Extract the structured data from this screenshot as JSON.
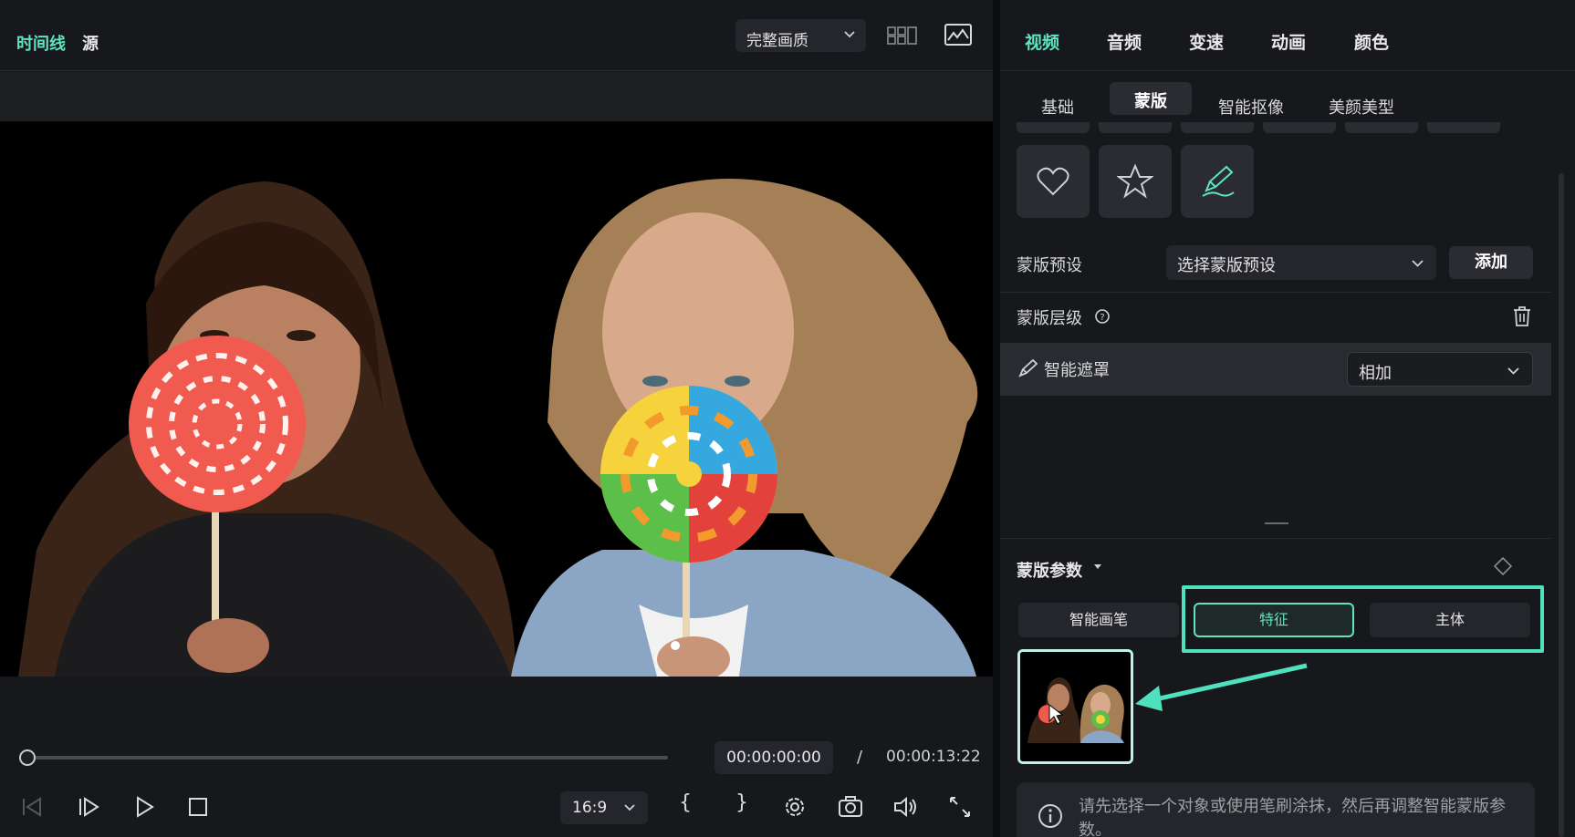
{
  "preview": {
    "tabs": [
      "时间线",
      "源"
    ],
    "quality_label": "完整画质",
    "current_time": "00:00:00:00",
    "separator": "/",
    "total_time": "00:00:13:22",
    "ratio": "16:9",
    "brace_open": "{",
    "brace_close": "}"
  },
  "panel": {
    "tabs": [
      "视频",
      "音频",
      "变速",
      "动画",
      "颜色"
    ],
    "subtabs": [
      "基础",
      "蒙版",
      "智能抠像",
      "美颜美型"
    ],
    "preset_label": "蒙版预设",
    "preset_placeholder": "选择蒙版预设",
    "add_label": "添加",
    "layer_label": "蒙版层级",
    "smart_mask_label": "智能遮罩",
    "blend_mode": "相加",
    "params_label": "蒙版参数",
    "modes": [
      "智能画笔",
      "特征",
      "主体"
    ],
    "info_text": "请先选择一个对象或使用笔刷涂抹，然后再调整智能蒙版参数。"
  },
  "colors": {
    "accent": "#5fe3c0",
    "highlight": "#4fe1bd"
  },
  "icons": [
    "heart-icon",
    "star-icon",
    "brush-icon",
    "help-icon",
    "trash-icon",
    "info-icon",
    "diamond-icon"
  ]
}
